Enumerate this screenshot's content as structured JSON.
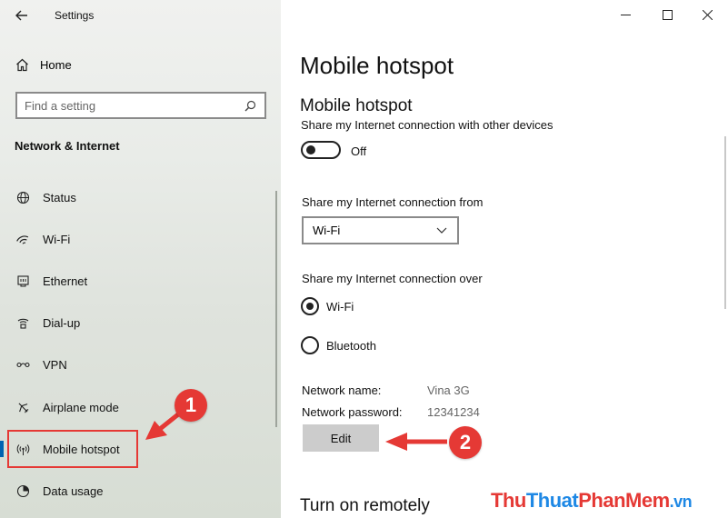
{
  "window": {
    "title": "Settings"
  },
  "sidebar": {
    "home_label": "Home",
    "search_placeholder": "Find a setting",
    "section_title": "Network & Internet",
    "items": [
      {
        "label": "Status",
        "icon": "globe-icon"
      },
      {
        "label": "Wi-Fi",
        "icon": "wifi-icon"
      },
      {
        "label": "Ethernet",
        "icon": "ethernet-icon"
      },
      {
        "label": "Dial-up",
        "icon": "dialup-icon"
      },
      {
        "label": "VPN",
        "icon": "vpn-icon"
      },
      {
        "label": "Airplane mode",
        "icon": "airplane-icon"
      },
      {
        "label": "Mobile hotspot",
        "icon": "hotspot-icon",
        "active": true
      },
      {
        "label": "Data usage",
        "icon": "data-usage-icon"
      }
    ]
  },
  "main": {
    "page_title": "Mobile hotspot",
    "section_title": "Mobile hotspot",
    "share_desc": "Share my Internet connection with other devices",
    "toggle_state": "Off",
    "share_from_label": "Share my Internet connection from",
    "share_from_value": "Wi-Fi",
    "share_over_label": "Share my Internet connection over",
    "share_over_options": [
      {
        "label": "Wi-Fi",
        "selected": true
      },
      {
        "label": "Bluetooth",
        "selected": false
      }
    ],
    "network_name_label": "Network name:",
    "network_name_value": "Vina 3G",
    "network_password_label": "Network password:",
    "network_password_value": "12341234",
    "edit_label": "Edit",
    "remote_title": "Turn on remotely"
  },
  "annotations": {
    "step1": "1",
    "step2": "2",
    "accent_color": "#e53935"
  },
  "watermark": {
    "part1": "Thu",
    "part2": "Thuat",
    "part3": "PhanMem",
    "part4": ".vn"
  }
}
